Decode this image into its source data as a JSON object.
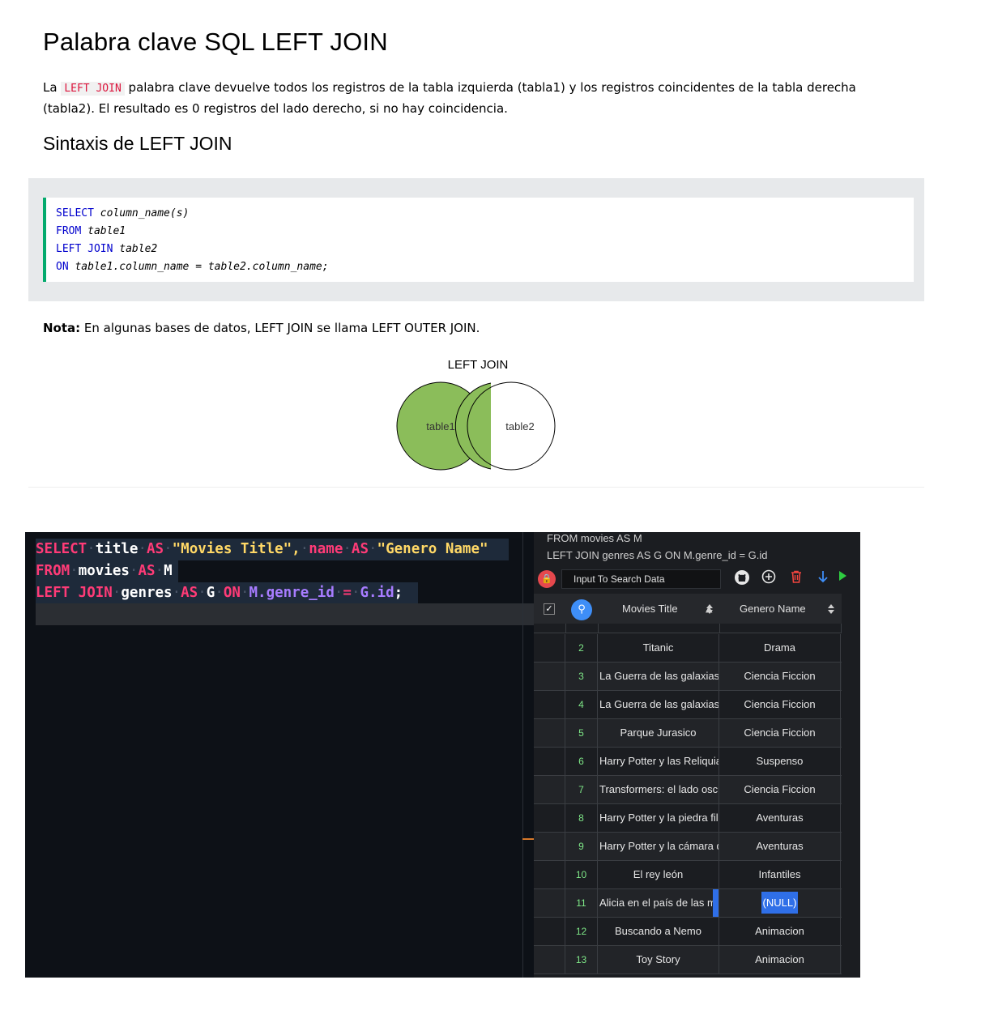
{
  "page": {
    "title": "Palabra clave SQL LEFT JOIN",
    "intro_before": "La ",
    "intro_keyword": "LEFT JOIN",
    "intro_after": " palabra clave devuelve todos los registros de la tabla izquierda (tabla1) y los registros coincidentes de la tabla derecha (tabla2). El resultado es 0 registros del lado derecho, si no hay coincidencia.",
    "syntax_heading": "Sintaxis de LEFT JOIN",
    "code": {
      "l1_kw": "SELECT",
      "l1_rest": " column_name(s)",
      "l2_kw": "FROM",
      "l2_rest": " table1",
      "l3_kw": "LEFT JOIN",
      "l3_rest": " table2",
      "l4_kw": "ON",
      "l4_rest": " table1.column_name = table2.column_name;"
    },
    "note_label": "Nota:",
    "note_text": " En algunas bases de datos, LEFT JOIN se llama LEFT OUTER JOIN.",
    "venn": {
      "title": "LEFT JOIN",
      "left": "table1",
      "right": "table2",
      "left_color": "#8bbd5a"
    }
  },
  "editor": {
    "select": "SELECT",
    "title": "title",
    "as": "AS",
    "movies_title": "\"Movies Title\",",
    "name": "name",
    "genero_name": "\"Genero Name\"",
    "from": "FROM",
    "movies": "movies",
    "m": "M",
    "left_join": "LEFT JOIN",
    "genres": "genres",
    "g": "G",
    "on": "ON",
    "m_dot": "M.",
    "genre_id": "genre_id",
    "eq": "=",
    "g_dot": "G.",
    "id": "id",
    "semi": ";"
  },
  "panel": {
    "sql_line1": "FROM movies AS M",
    "sql_line2": "LEFT JOIN genres AS G ON M.genre_id = G.id",
    "search_placeholder": "Input To Search Data",
    "columns": [
      "Movies Title",
      "Genero Name"
    ],
    "rows": [
      {
        "n": "2",
        "title": "Titanic",
        "genre": "Drama"
      },
      {
        "n": "3",
        "title": "La Guerra de las galaxias:",
        "genre": "Ciencia Ficcion"
      },
      {
        "n": "4",
        "title": "La Guerra de las galaxias:",
        "genre": "Ciencia Ficcion"
      },
      {
        "n": "5",
        "title": "Parque Jurasico",
        "genre": "Ciencia Ficcion"
      },
      {
        "n": "6",
        "title": "Harry Potter y las Reliquia",
        "genre": "Suspenso"
      },
      {
        "n": "7",
        "title": "Transformers: el lado oscu",
        "genre": "Ciencia Ficcion"
      },
      {
        "n": "8",
        "title": "Harry Potter y la piedra fil",
        "genre": "Aventuras"
      },
      {
        "n": "9",
        "title": "Harry Potter y la cámara d",
        "genre": "Aventuras"
      },
      {
        "n": "10",
        "title": "El rey león",
        "genre": "Infantiles"
      },
      {
        "n": "11",
        "title": "Alicia en el país de las ma",
        "genre": "(NULL)"
      },
      {
        "n": "12",
        "title": "Buscando a Nemo",
        "genre": "Animacion"
      },
      {
        "n": "13",
        "title": "Toy Story",
        "genre": "Animacion"
      }
    ]
  }
}
